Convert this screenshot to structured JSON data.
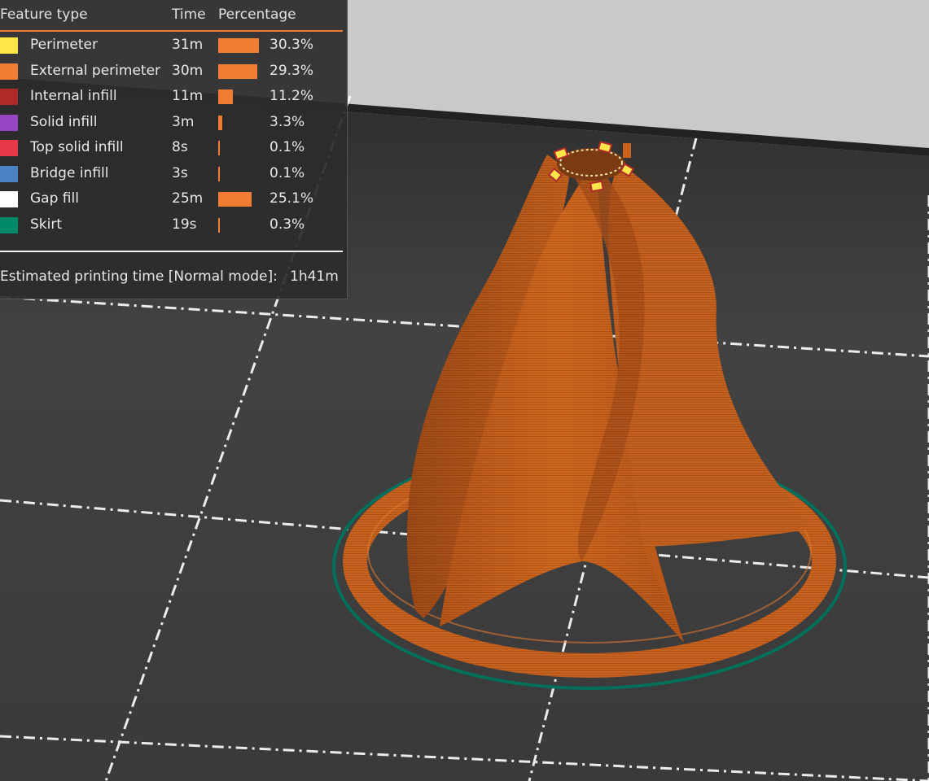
{
  "legend": {
    "headers": {
      "feature": "Feature type",
      "time": "Time",
      "percentage": "Percentage"
    },
    "rows": [
      {
        "name": "Perimeter",
        "time": "31m",
        "percent": "30.3%",
        "fraction": 0.303,
        "color": "#ffe54a"
      },
      {
        "name": "External perimeter",
        "time": "30m",
        "percent": "29.3%",
        "fraction": 0.293,
        "color": "#f07d33"
      },
      {
        "name": "Internal infill",
        "time": "11m",
        "percent": "11.2%",
        "fraction": 0.112,
        "color": "#b02a2a"
      },
      {
        "name": "Solid infill",
        "time": "3m",
        "percent": "3.3%",
        "fraction": 0.033,
        "color": "#9646c4"
      },
      {
        "name": "Top solid infill",
        "time": "8s",
        "percent": "0.1%",
        "fraction": 0.001,
        "color": "#e63846"
      },
      {
        "name": "Bridge infill",
        "time": "3s",
        "percent": "0.1%",
        "fraction": 0.001,
        "color": "#4a82c3"
      },
      {
        "name": "Gap fill",
        "time": "25m",
        "percent": "25.1%",
        "fraction": 0.251,
        "color": "#ffffff"
      },
      {
        "name": "Skirt",
        "time": "19s",
        "percent": "0.3%",
        "fraction": 0.003,
        "color": "#008a6a"
      }
    ],
    "estimate_label": "Estimated printing time [Normal mode]:",
    "estimate_value": "1h41m"
  },
  "colors": {
    "accent": "#f07d33",
    "model": "#c8621f",
    "model_dark": "#a9501a",
    "skirt": "#00705a",
    "bed": "#3e3e3e",
    "background": "#c8c8c8",
    "grid": "#ffffff"
  }
}
